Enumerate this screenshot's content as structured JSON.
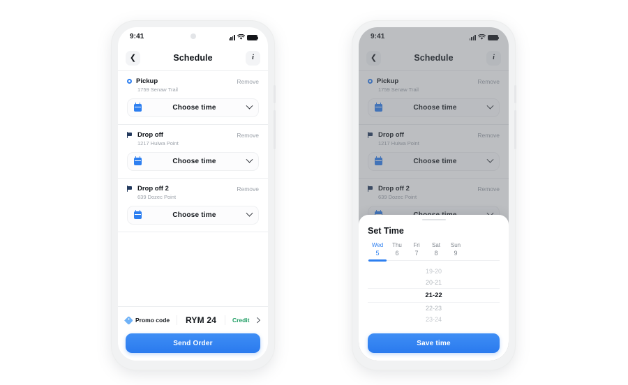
{
  "app": {
    "status_bar": {
      "time": "9:41"
    },
    "nav": {
      "back_icon": "chevron-left-icon",
      "title": "Schedule",
      "info_label": "i"
    }
  },
  "stops": [
    {
      "marker": "pickup-dot-icon",
      "title": "Pickup",
      "address": "1759 Senaw Trail",
      "remove_label": "Remove",
      "choose_label": "Choose time"
    },
    {
      "marker": "flag-icon",
      "title": "Drop off",
      "address": "1217 Huiwa Point",
      "remove_label": "Remove",
      "choose_label": "Choose time"
    },
    {
      "marker": "flag-icon",
      "title": "Drop off 2",
      "address": "639 Dozec Point",
      "remove_label": "Remove",
      "choose_label": "Choose time"
    }
  ],
  "footer": {
    "promo_label": "Promo code",
    "promo_code": "RYM 24",
    "payment_label": "Credit",
    "send_order_label": "Send Order"
  },
  "sheet": {
    "title": "Set Time",
    "days": [
      {
        "name": "Wed",
        "num": "5",
        "active": true
      },
      {
        "name": "Thu",
        "num": "6",
        "active": false
      },
      {
        "name": "Fri",
        "num": "7",
        "active": false
      },
      {
        "name": "Sat",
        "num": "8",
        "active": false
      },
      {
        "name": "Sun",
        "num": "9",
        "active": false
      }
    ],
    "slots": [
      {
        "label": "19-20",
        "state": "far"
      },
      {
        "label": "20-21",
        "state": "near"
      },
      {
        "label": "21-22",
        "state": "selected"
      },
      {
        "label": "22-23",
        "state": "near"
      },
      {
        "label": "23-24",
        "state": "far"
      }
    ],
    "save_label": "Save time"
  },
  "colors": {
    "accent_blue": "#2d7ff0",
    "credit_green": "#1d9d63",
    "muted_gray": "#9ba1a9",
    "flag_navy": "#233a5e"
  }
}
